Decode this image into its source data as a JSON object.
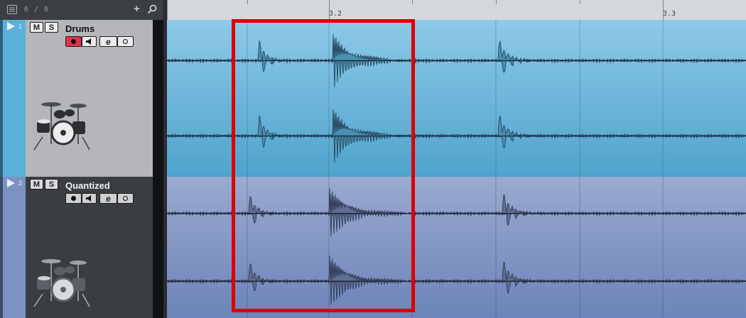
{
  "track_list": {
    "track_count": "6 / 6",
    "menu_icon": "list-menu-icon",
    "add_icon": "plus-icon",
    "search_icon": "search-icon"
  },
  "ruler": {
    "bar_labels": [
      "3.2",
      "3.3"
    ]
  },
  "tracks": [
    {
      "number": "1",
      "name": "Drums",
      "mute_label": "M",
      "solo_label": "S",
      "edit_label": "e",
      "record_armed": true,
      "icons": [
        "record-icon",
        "monitor-speaker-icon",
        "edit-instrument-icon",
        "read-automation-icon",
        "drum-kit-icon"
      ],
      "color": "#5ab0da"
    },
    {
      "number": "2",
      "name": "Quantized",
      "mute_label": "M",
      "solo_label": "S",
      "edit_label": "e",
      "record_armed": false,
      "icons": [
        "record-icon",
        "monitor-speaker-icon",
        "edit-instrument-icon",
        "read-automation-icon",
        "drum-kit-icon"
      ],
      "color": "#7b93c2"
    }
  ],
  "colors": {
    "highlight": "#dc0000",
    "track1_event": "#63aed5",
    "track2_event": "#8297c5",
    "record_active": "#e0334b"
  }
}
